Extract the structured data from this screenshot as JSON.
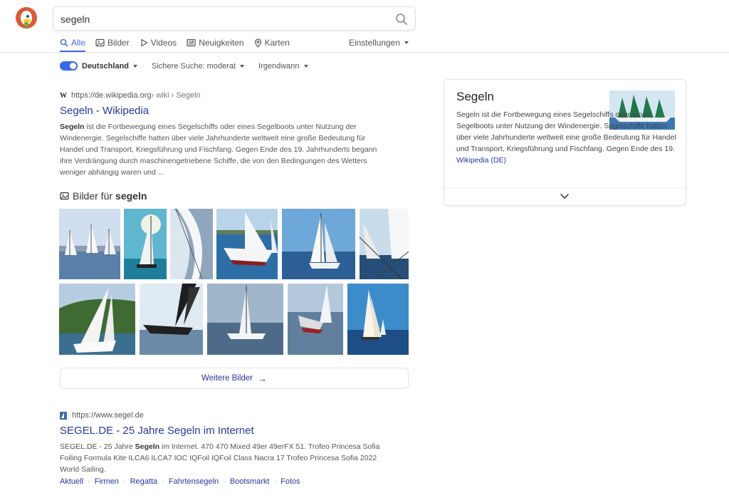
{
  "search": {
    "query": "segeln"
  },
  "tabs": [
    {
      "label": "Alle",
      "icon": "search-icon"
    },
    {
      "label": "Bilder",
      "icon": "image-icon"
    },
    {
      "label": "Videos",
      "icon": "play-icon"
    },
    {
      "label": "Neuigkeiten",
      "icon": "news-icon"
    },
    {
      "label": "Karten",
      "icon": "map-pin-icon"
    }
  ],
  "settings_label": "Einstellungen",
  "filters": {
    "region": "Deutschland",
    "safe_search": "Sichere Suche: moderat",
    "time": "Irgendwann"
  },
  "result1": {
    "domain": "https://de.wikipedia.org",
    "path": " › wiki › Segeln",
    "title": "Segeln - Wikipedia",
    "snippet_bold": "Segeln",
    "snippet_rest": " ist die Fortbewegung eines Segelschiffs oder eines Segelboots unter Nutzung der Windenergie. Segelschiffe hatten über viele Jahrhunderte weltweit eine große Bedeutung für Handel und Transport, Kriegsführung und Fischfang. Gegen Ende des 19. Jahrhunderts begann ihre Verdrängung durch maschinengetriebene Schiffe, die von den Bedingungen des Wetters weniger abhängig waren und ..."
  },
  "images": {
    "heading_prefix": "Bilder für ",
    "heading_query": "segeln",
    "more_label": "Weitere Bilder"
  },
  "result2": {
    "domain": "https://www.segel.de",
    "title": "SEGEL.DE - 25 Jahre Segeln im Internet",
    "snippet_pre": "SEGEL.DE - 25 Jahre ",
    "snippet_bold": "Segeln",
    "snippet_rest": " im Internet. 470 470 Mixed 49er 49erFX 51. Trofeo Princesa Sofia Foiling Formula Kite ILCA6 ILCA7 IOC IQFoil IQFoil Class Nacra 17 Trofeo Princesa Sofia 2022 World Sailing.",
    "sitelinks": [
      "Aktuell",
      "Firmen",
      "Regatta",
      "Fahrtensegeln",
      "Bootsmarkt",
      "Fotos"
    ]
  },
  "knowledge_panel": {
    "title": "Segeln",
    "text": "Segeln ist die Fortbewegung eines Segelschiffs oder eines Segelboots unter Nutzung der Windenergie. Segelschiffe hatten über viele Jahrhunderte weltweit eine große Bedeutung für Handel und Transport, Kriegsführung und Fischfang. Gegen Ende des 19. ",
    "source": "Wikipedia (DE)"
  },
  "colors": {
    "accent": "#3969ef",
    "link": "#2b35a2",
    "brand": "#de5833"
  }
}
